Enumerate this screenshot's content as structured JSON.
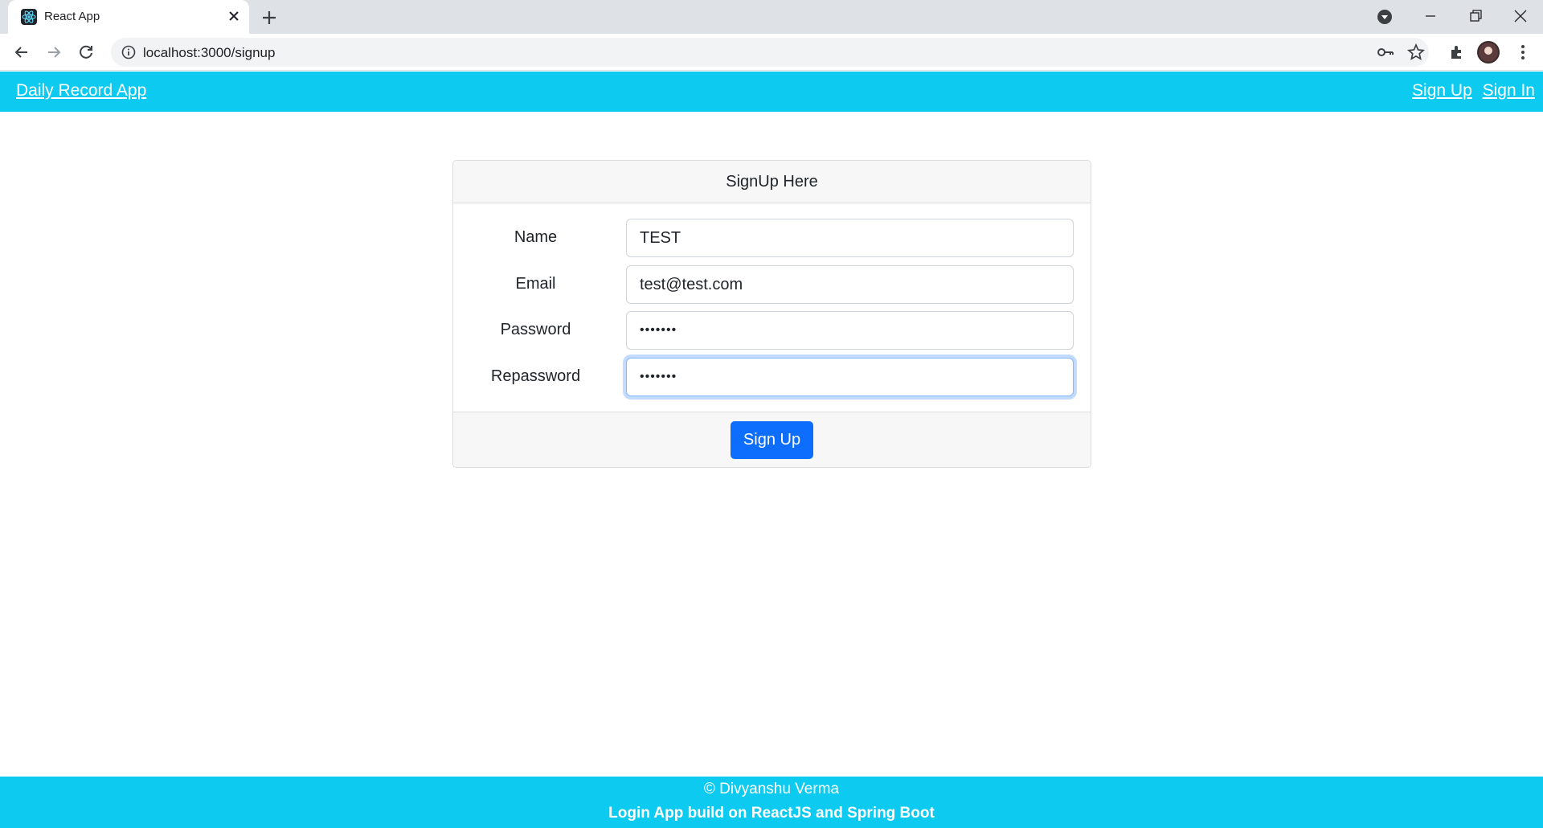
{
  "browser": {
    "tab": {
      "title": "React App"
    },
    "address": {
      "url": "localhost:3000/signup"
    }
  },
  "navbar": {
    "brand": "Daily Record App",
    "links": [
      "Sign Up",
      "Sign In"
    ]
  },
  "card": {
    "header": "SignUp Here",
    "fields": [
      {
        "label": "Name",
        "value": "TEST"
      },
      {
        "label": "Email",
        "value": "test@test.com"
      },
      {
        "label": "Password",
        "value": "•••••••"
      },
      {
        "label": "Repassword",
        "value": "•••••••"
      }
    ],
    "submit_label": "Sign Up"
  },
  "footer": {
    "line1": "© Divyanshu Verma",
    "line2": "Login App build on ReactJS and Spring Boot"
  },
  "colors": {
    "navbar_bg": "#0dcaf0",
    "primary_button": "#0d6efd",
    "focus_ring": "#86b7fe"
  },
  "icons": [
    "react-favicon-icon",
    "close-icon",
    "plus-icon",
    "media-control-icon",
    "minimize-icon",
    "restore-icon",
    "window-close-icon",
    "back-arrow-icon",
    "forward-arrow-icon",
    "reload-icon",
    "info-icon",
    "key-icon",
    "star-icon",
    "extensions-icon",
    "profile-avatar",
    "kebab-menu-icon"
  ]
}
